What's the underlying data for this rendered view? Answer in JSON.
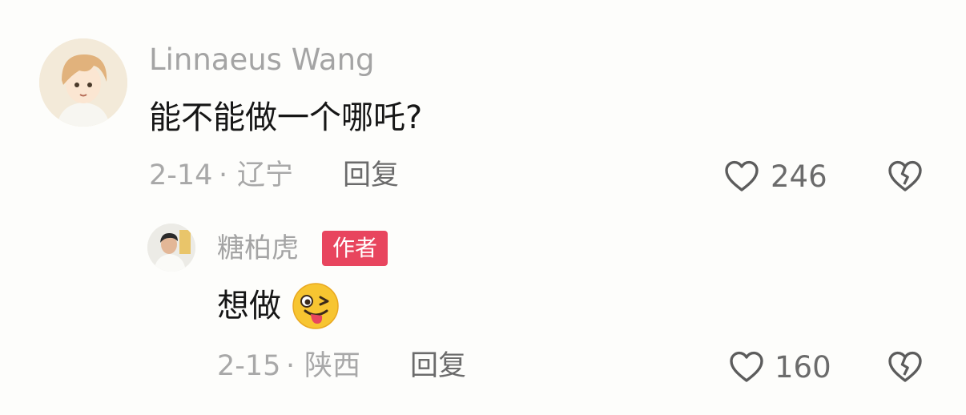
{
  "comments": [
    {
      "username": "Linnaeus Wang",
      "text": "能不能做一个哪吒?",
      "date": "2-14",
      "separator": "·",
      "location": "辽宁",
      "reply_label": "回复",
      "like_count": "246",
      "like_icon": "heart-outline-icon",
      "dislike_icon": "broken-heart-icon"
    },
    {
      "username": "糖柏虎",
      "badge": "作者",
      "text": "想做",
      "emoji": "winking-face-with-tongue",
      "date": "2-15",
      "separator": "·",
      "location": "陕西",
      "reply_label": "回复",
      "like_count": "160",
      "like_icon": "heart-outline-icon",
      "dislike_icon": "broken-heart-icon"
    }
  ],
  "colors": {
    "background": "#fdfdfb",
    "badge": "#e8455e",
    "username": "#a4a4a4",
    "text": "#161616"
  }
}
